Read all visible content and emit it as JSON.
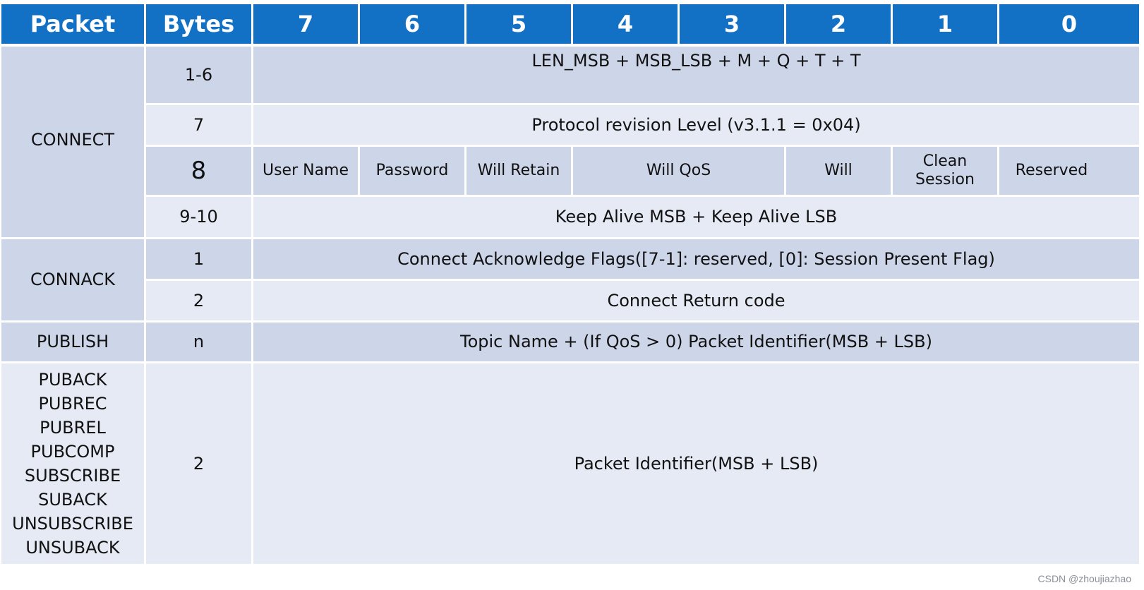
{
  "header": {
    "packet": "Packet",
    "bytes": "Bytes",
    "bits": [
      "7",
      "6",
      "5",
      "4",
      "3",
      "2",
      "1",
      "0"
    ]
  },
  "connect": {
    "packet": "CONNECT",
    "rows": [
      {
        "bytes": "1-6",
        "content": "LEN_MSB + MSB_LSB + M + Q + T + T"
      },
      {
        "bytes": "7",
        "content": "Protocol revision  Level (v3.1.1 = 0x04)"
      },
      {
        "bytes": "8",
        "flags": [
          "User Name",
          "Password",
          "Will Retain",
          "Will QoS",
          "Will",
          "Clean Session",
          "Reserved"
        ]
      },
      {
        "bytes": "9-10",
        "content": "Keep Alive MSB + Keep Alive LSB"
      }
    ]
  },
  "connack": {
    "packet": "CONNACK",
    "rows": [
      {
        "bytes": "1",
        "content": "Connect Acknowledge Flags([7-1]: reserved, [0]: Session Present Flag)"
      },
      {
        "bytes": "2",
        "content": "Connect Return code"
      }
    ]
  },
  "publish": {
    "packet": "PUBLISH",
    "bytes": "n",
    "content": "Topic Name + (If QoS > 0) Packet Identifier(MSB + LSB)"
  },
  "others": {
    "packets": [
      "PUBACK",
      "PUBREC",
      "PUBREL",
      "PUBCOMP",
      "SUBSCRIBE",
      "SUBACK",
      "UNSUBSCRIBE",
      "UNSUBACK"
    ],
    "bytes": "2",
    "content": "Packet Identifier(MSB + LSB)"
  },
  "watermark": "CSDN @zhoujiazhao"
}
